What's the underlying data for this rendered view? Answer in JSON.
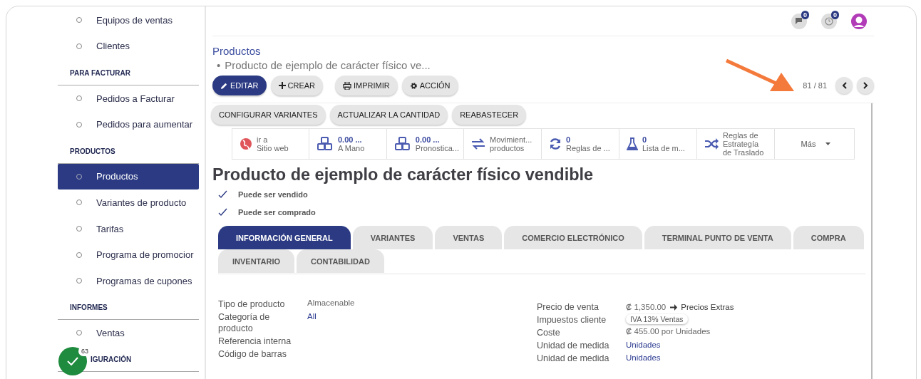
{
  "sidebar": {
    "items": [
      {
        "kind": "item",
        "label": "Equipos de ventas",
        "selected": false
      },
      {
        "kind": "item",
        "label": "Clientes",
        "selected": false
      },
      {
        "kind": "heading",
        "label": "PARA FACTURAR"
      },
      {
        "kind": "item",
        "label": "Pedidos a Facturar",
        "selected": false
      },
      {
        "kind": "item",
        "label": "Pedidos para aumentar",
        "selected": false
      },
      {
        "kind": "heading",
        "label": "PRODUCTOS"
      },
      {
        "kind": "item",
        "label": "Productos",
        "selected": true
      },
      {
        "kind": "item",
        "label": "Variantes de producto",
        "selected": false
      },
      {
        "kind": "item",
        "label": "Tarifas",
        "selected": false
      },
      {
        "kind": "item",
        "label": "Programa de promocior",
        "selected": false
      },
      {
        "kind": "item",
        "label": "Programas de cupones",
        "selected": false
      },
      {
        "kind": "heading",
        "label": "INFORMES"
      },
      {
        "kind": "item",
        "label": "Ventas",
        "selected": false
      },
      {
        "kind": "heading",
        "label": "IGURACIÓN"
      }
    ]
  },
  "floating_badge": {
    "count": "63"
  },
  "topbar": {
    "messages_count": "0",
    "activities_count": "0"
  },
  "breadcrumb": {
    "parent": "Productos",
    "separator": "•",
    "current": "Producto de ejemplo de carácter físico ve..."
  },
  "actions": [
    {
      "label": "EDITAR",
      "primary": true
    },
    {
      "label": "CREAR",
      "primary": false
    },
    {
      "label": "IMPRIMIR",
      "primary": false
    },
    {
      "label": "ACCIÓN",
      "primary": false
    }
  ],
  "pager": {
    "text": "81 / 81"
  },
  "header_buttons": [
    "CONFIGURAR VARIANTES",
    "ACTUALIZAR LA CANTIDAD",
    "REABASTECER"
  ],
  "stat_buttons": [
    {
      "kind": "stat",
      "lines": [
        "ir a",
        "Sitio web"
      ]
    },
    {
      "kind": "stat",
      "value": "0.00 ...",
      "lines": [
        "A Mano"
      ]
    },
    {
      "kind": "stat",
      "value": "0.00 ...",
      "lines": [
        "Pronostica..."
      ]
    },
    {
      "kind": "stat",
      "lines": [
        "Movimient...",
        "productos"
      ]
    },
    {
      "kind": "stat",
      "value": "0",
      "lines": [
        "Reglas de ..."
      ]
    },
    {
      "kind": "stat",
      "value": "0",
      "lines": [
        "Lista de m..."
      ]
    },
    {
      "kind": "stat",
      "lines": [
        "Reglas de",
        "Estrategía",
        "de Traslado"
      ]
    },
    {
      "kind": "more",
      "label": "Más"
    }
  ],
  "title": "Producto de ejemplo de carácter físico vendible",
  "options": [
    {
      "label": "Puede ser vendido",
      "checked": true
    },
    {
      "label": "Puede ser comprado",
      "checked": true
    }
  ],
  "tab_rows": [
    [
      {
        "label": "INFORMACIÓN GENERAL",
        "selected": true
      },
      {
        "label": "VARIANTES",
        "selected": false
      },
      {
        "label": "VENTAS",
        "selected": false
      },
      {
        "label": "COMERCIO ELECTRÓNICO",
        "selected": false
      },
      {
        "label": "TERMINAL PUNTO DE VENTA",
        "selected": false
      },
      {
        "label": "COMPRA",
        "selected": false
      }
    ],
    [
      {
        "label": "INVENTARIO",
        "selected": false
      },
      {
        "label": "CONTABILIDAD",
        "selected": false
      }
    ]
  ],
  "fields_left": [
    {
      "label": "Tipo de producto",
      "kind": "text",
      "value": "Almacenable"
    },
    {
      "label": "Categoría de producto",
      "kind": "link",
      "value": "All"
    },
    {
      "label": "Referencia interna",
      "kind": "empty"
    },
    {
      "label": "Código de barras",
      "kind": "empty"
    }
  ],
  "fields_right": [
    {
      "label": "Precio de venta",
      "kind": "price",
      "value": "₡ 1,350.00",
      "link": "Precios Extras"
    },
    {
      "label": "Impuestos cliente",
      "kind": "tag",
      "value": "IVA 13% Ventas"
    },
    {
      "label": "Coste",
      "kind": "text",
      "value": "₡ 455.00 por Unidades"
    },
    {
      "label": "Unidad de medida",
      "kind": "link",
      "value": "Unidades"
    },
    {
      "label": "Unidad de medida",
      "kind": "link",
      "value": "Unidades"
    }
  ]
}
